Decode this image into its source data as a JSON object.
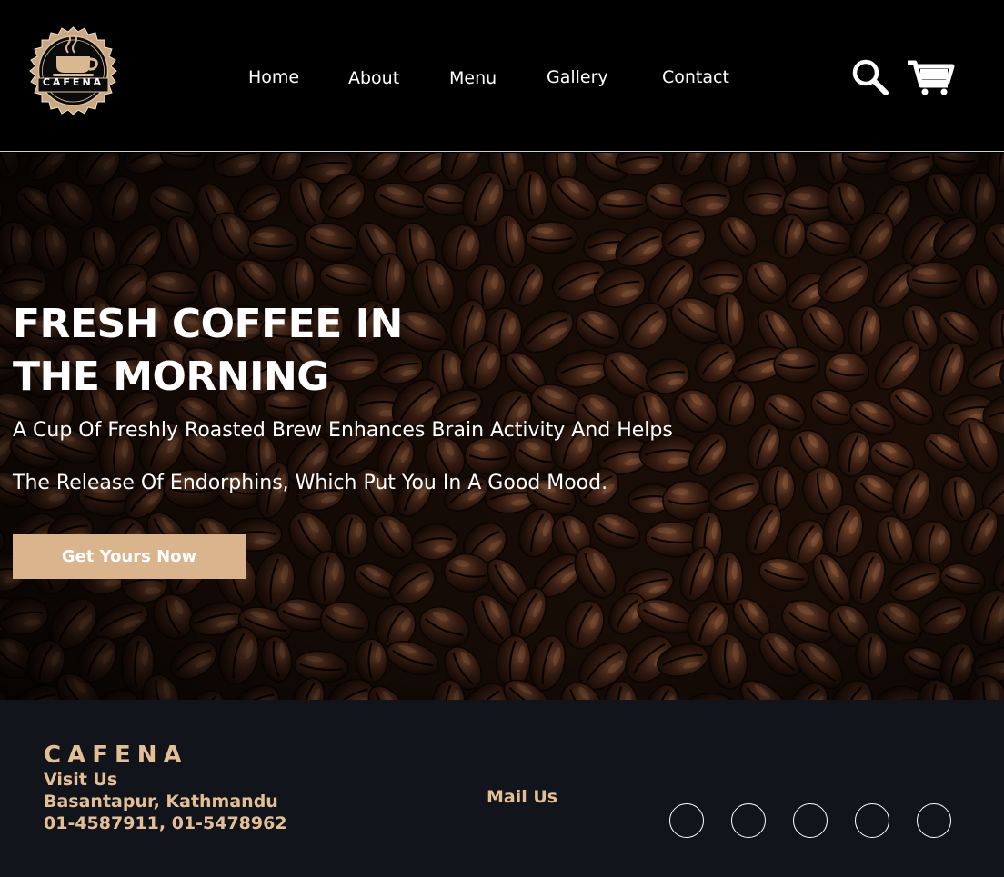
{
  "brand": {
    "name": "CAFENA",
    "logo_icon": "coffee-cup-steam-icon"
  },
  "colors": {
    "accent": "#dab48c",
    "footer_text": "#e2bf94",
    "footer_bg": "#12141c",
    "header_bg": "#000000"
  },
  "nav": {
    "items": [
      {
        "label": "Home"
      },
      {
        "label": "About"
      },
      {
        "label": "Menu"
      },
      {
        "label": "Gallery"
      },
      {
        "label": "Contact"
      }
    ],
    "icons": [
      "search-icon",
      "cart-icon"
    ]
  },
  "hero": {
    "title_line_1": "FRESH COFFEE IN",
    "title_line_2": "THE MORNING",
    "subtitle_line_1": "A Cup Of Freshly Roasted Brew Enhances Brain Activity And Helps",
    "subtitle_line_2": "The Release Of Endorphins, Which Put You In A Good Mood.",
    "cta_label": "Get Yours Now",
    "background": "coffee-beans-image"
  },
  "footer": {
    "brand": "CAFENA",
    "visit_label": "Visit Us",
    "address": "Basantapur, Kathmandu",
    "phones": "01-4587911, 01-5478962",
    "mail_label": "Mail Us",
    "social_icons": [
      "social-icon",
      "social-icon",
      "social-icon",
      "social-icon",
      "social-icon"
    ]
  }
}
